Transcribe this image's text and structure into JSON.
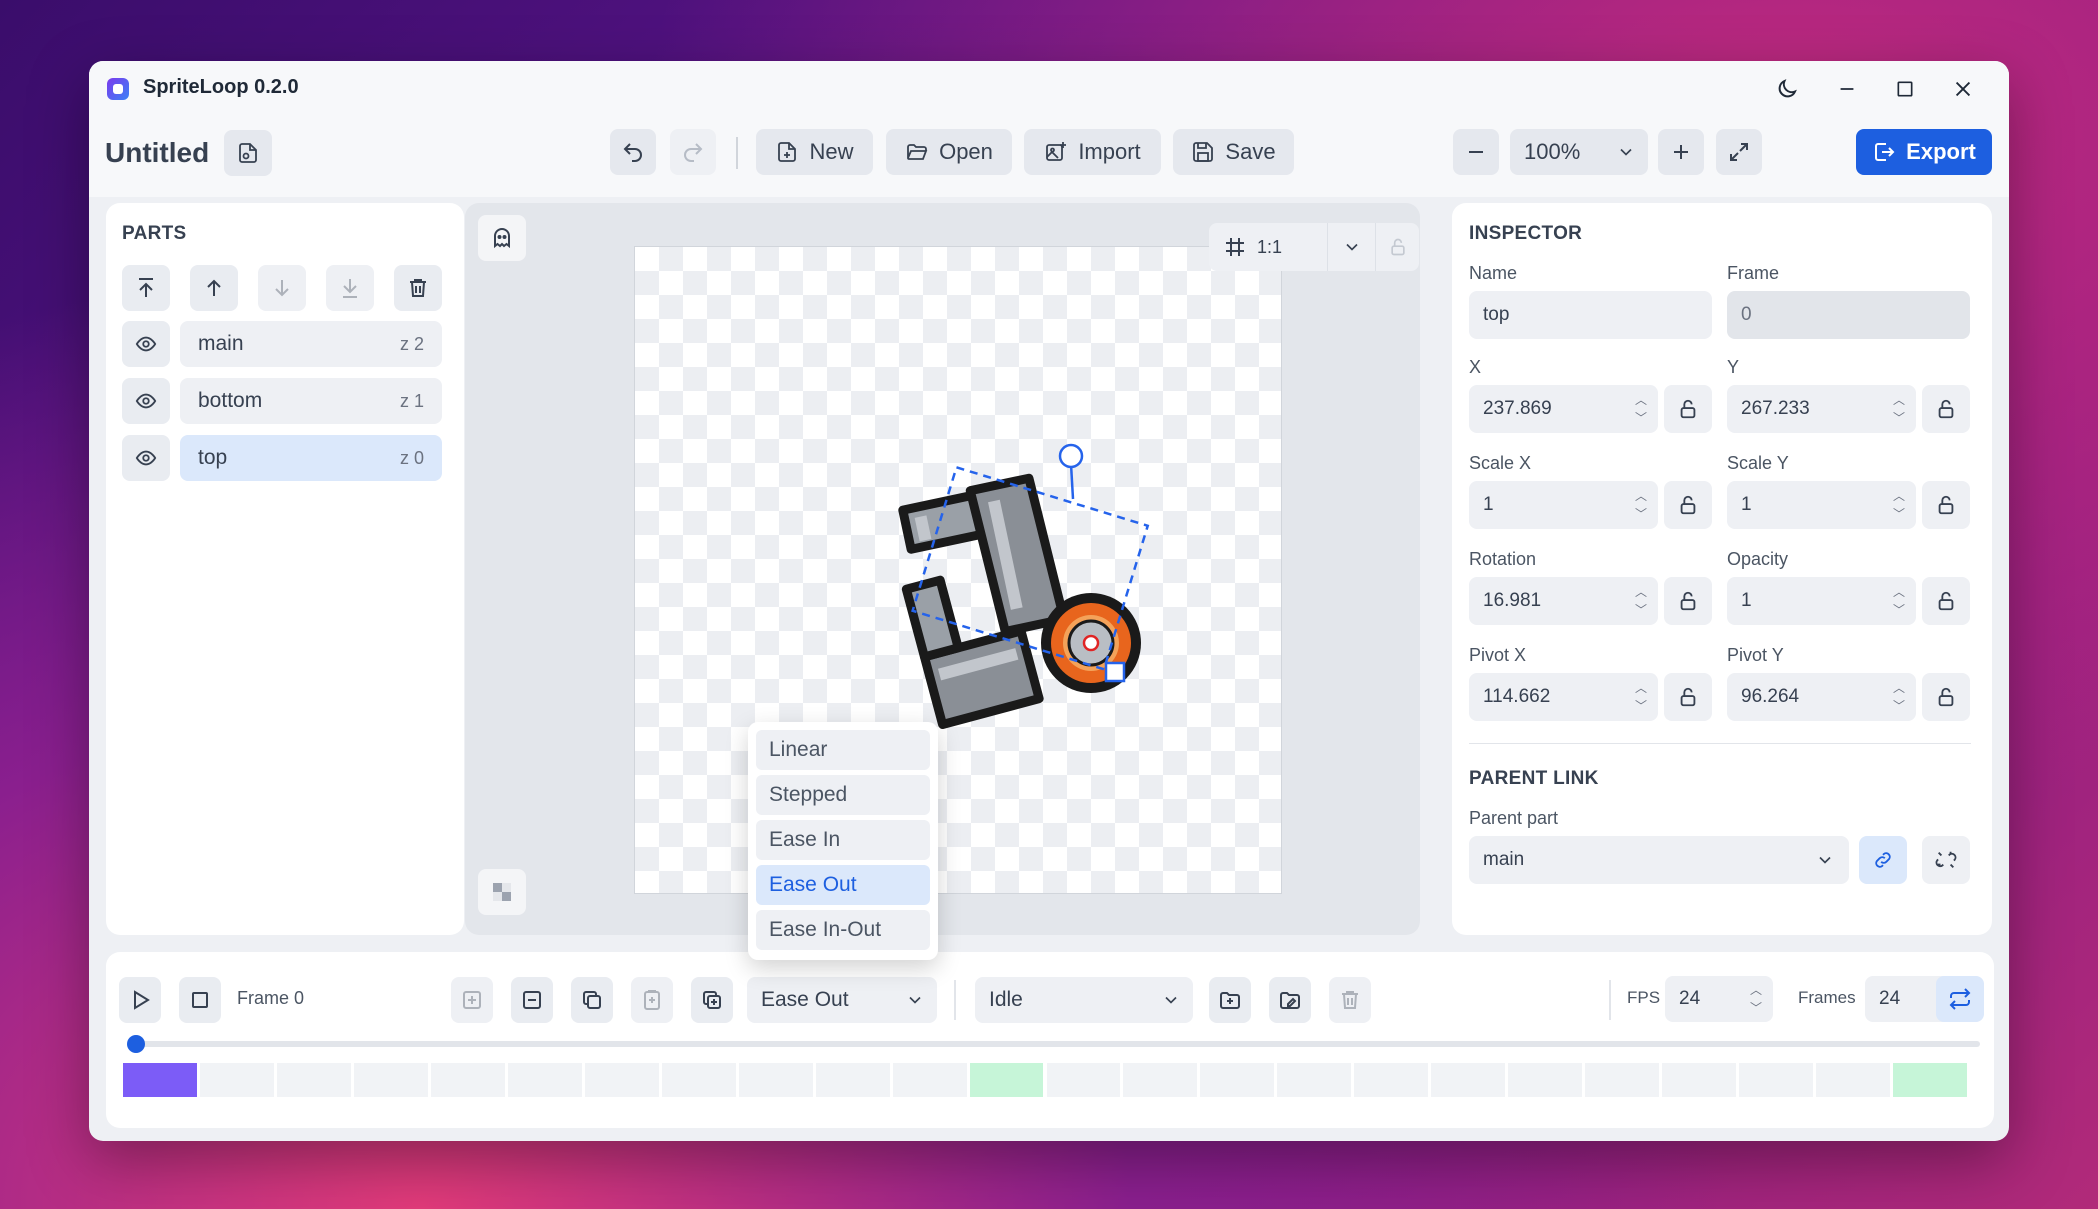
{
  "app": {
    "title": "SpriteLoop 0.2.0"
  },
  "toolbar": {
    "doc_title": "Untitled",
    "new_label": "New",
    "open_label": "Open",
    "import_label": "Import",
    "save_label": "Save",
    "zoom": "100%",
    "export_label": "Export"
  },
  "parts": {
    "title": "PARTS",
    "items": [
      {
        "name": "main",
        "z": "z 2"
      },
      {
        "name": "bottom",
        "z": "z 1"
      },
      {
        "name": "top",
        "z": "z 0"
      }
    ]
  },
  "canvas": {
    "ratio_label": "1:1"
  },
  "inspector": {
    "title": "INSPECTOR",
    "name_label": "Name",
    "name_value": "top",
    "frame_label": "Frame",
    "frame_value": "0",
    "x_label": "X",
    "x_value": "237.869",
    "y_label": "Y",
    "y_value": "267.233",
    "scale_x_label": "Scale X",
    "scale_x_value": "1",
    "scale_y_label": "Scale Y",
    "scale_y_value": "1",
    "rotation_label": "Rotation",
    "rotation_value": "16.981",
    "opacity_label": "Opacity",
    "opacity_value": "1",
    "pivot_x_label": "Pivot X",
    "pivot_x_value": "114.662",
    "pivot_y_label": "Pivot Y",
    "pivot_y_value": "96.264"
  },
  "parent_link": {
    "title": "PARENT LINK",
    "parent_label": "Parent part",
    "parent_value": "main"
  },
  "easing_menu": {
    "options": [
      "Linear",
      "Stepped",
      "Ease In",
      "Ease Out",
      "Ease In-Out"
    ],
    "selected": "Ease Out"
  },
  "timeline": {
    "frame_label": "Frame 0",
    "easing_value": "Ease Out",
    "animation_value": "Idle",
    "fps_label": "FPS",
    "fps_value": "24",
    "frames_label": "Frames",
    "frames_value": "24",
    "current_frame": 0,
    "keyframes": [
      0,
      11,
      23
    ]
  },
  "colors": {
    "accent": "#1d5fe0",
    "current_frame": "#7c5cf7",
    "keyframe": "#c6f5d8",
    "selected_row": "#dbe8fb"
  }
}
